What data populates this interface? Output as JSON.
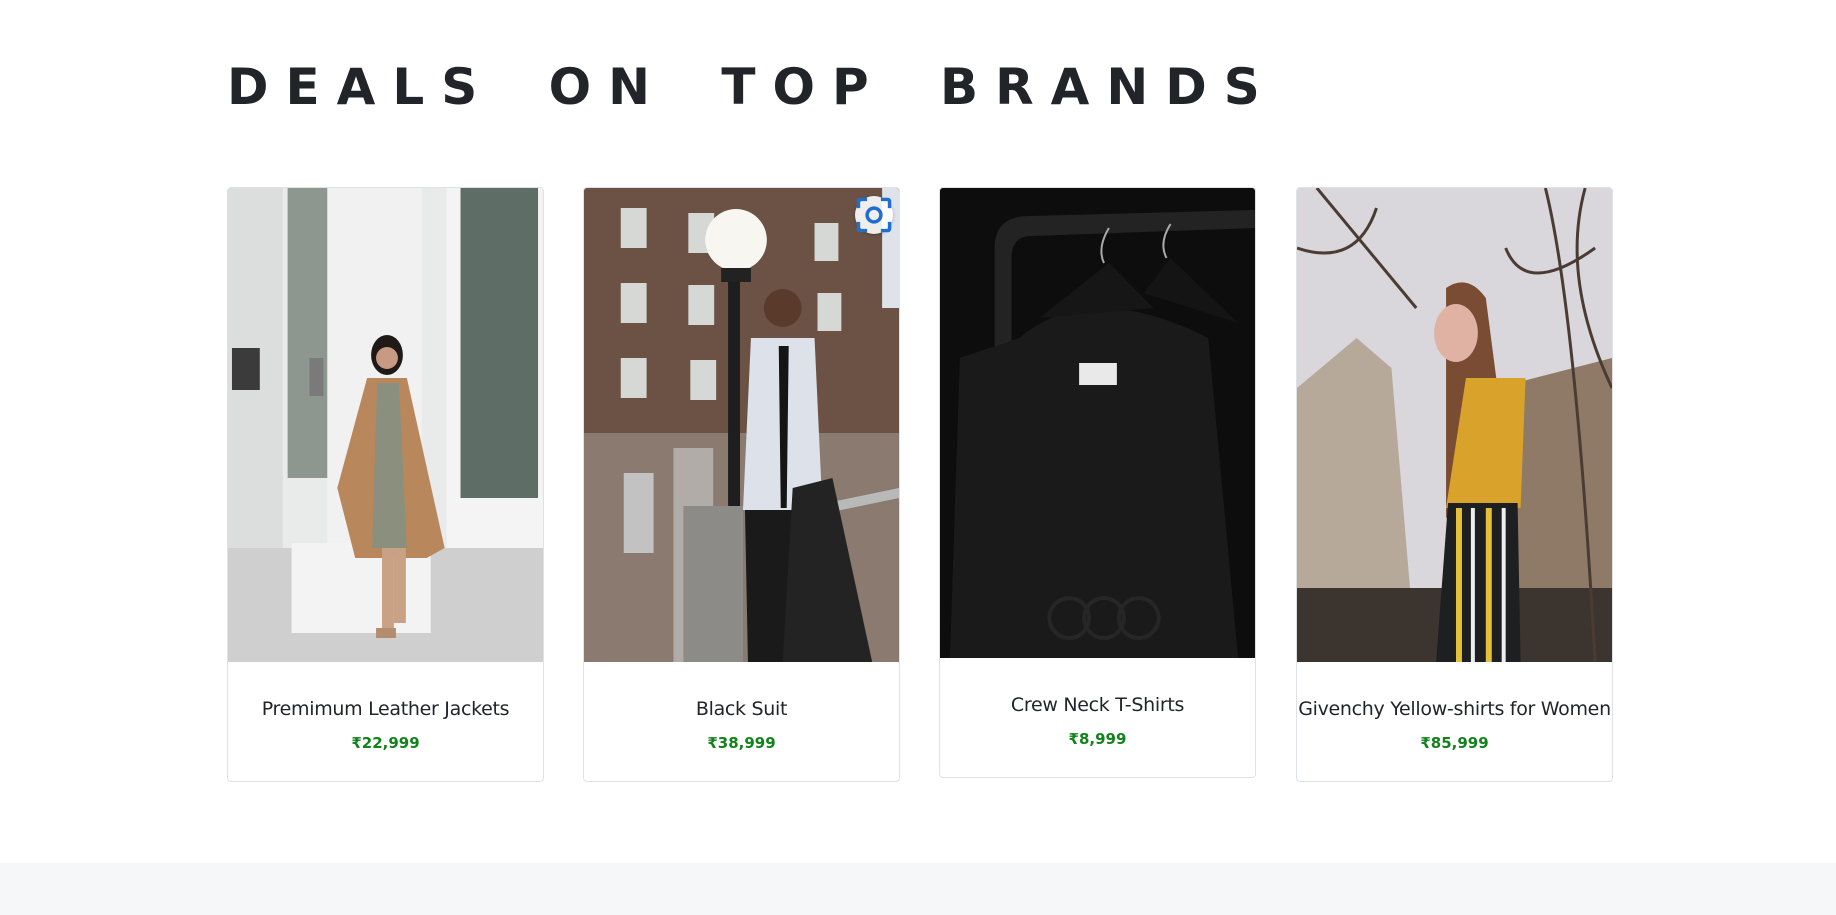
{
  "section": {
    "title": "DEALS ON TOP BRANDS"
  },
  "products": [
    {
      "title": "Premimum Leather Jackets",
      "price": "₹22,999",
      "image": "woman-in-camel-coat"
    },
    {
      "title": "Black Suit",
      "price": "₹38,999",
      "image": "man-in-white-shirt-black-tie"
    },
    {
      "title": "Crew Neck T-Shirts",
      "price": "₹8,999",
      "image": "black-sweatshirts-on-hangers"
    },
    {
      "title": "Givenchy Yellow-shirts for Women",
      "price": "₹85,999",
      "image": "woman-in-yellow-sweater"
    }
  ],
  "overlay": {
    "icon": "visual-search-icon"
  },
  "colors": {
    "price": "#12831b",
    "heading": "#212529",
    "card_border": "#dfe2e5"
  }
}
